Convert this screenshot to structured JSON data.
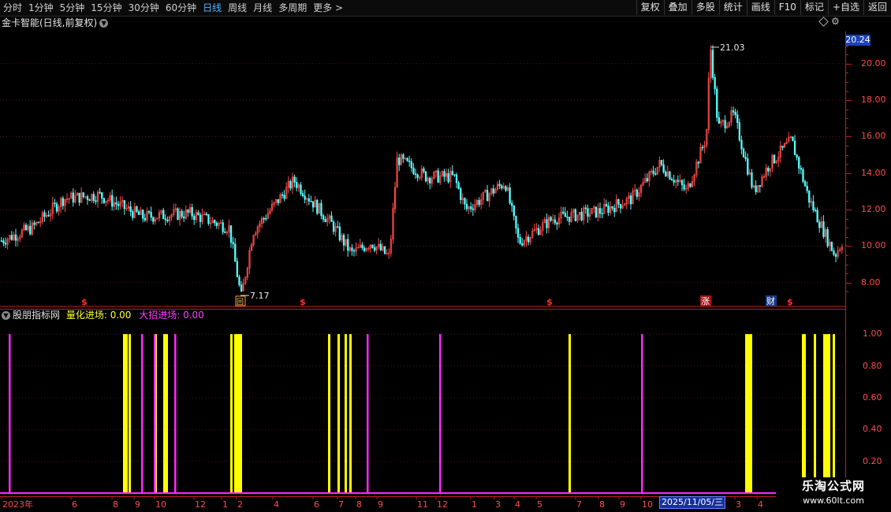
{
  "toolbar": {
    "periods": [
      "分时",
      "1分钟",
      "5分钟",
      "15分钟",
      "30分钟",
      "60分钟",
      "日线",
      "周线",
      "月线",
      "多周期",
      "更多 >"
    ],
    "active_period": "日线",
    "buttons": [
      "复权",
      "叠加",
      "多股",
      "统计",
      "画线",
      "F10",
      "标记",
      "+自选",
      "返回"
    ]
  },
  "stock_title": "金卡智能(日线,前复权)",
  "price_axis": {
    "labels": [
      "20.00",
      "18.00",
      "16.00",
      "14.00",
      "12.00",
      "10.00",
      "8.00"
    ],
    "current_price": "20.24"
  },
  "annotations": {
    "high": "21.03",
    "low": "7.17"
  },
  "event_markers": {
    "s_label": "$",
    "box_label": "回",
    "zhang_label": "涨",
    "cai_label": "财"
  },
  "indicator": {
    "name": "股朋指标网",
    "line1_label": "量化进场: 0.00",
    "line2_label": "大招进场: 0.00",
    "axis_labels": [
      "1.00",
      "0.80",
      "0.60",
      "0.40",
      "0.20"
    ]
  },
  "xaxis": {
    "labels": [
      "2023年",
      "6",
      "8",
      "9",
      "10",
      "12",
      "1",
      "2",
      "4",
      "6",
      "7",
      "8",
      "9",
      "11",
      "12",
      "1",
      "3",
      "4",
      "5",
      "7",
      "8",
      "9",
      "10",
      "3",
      "4"
    ],
    "cursor_date": "2025/11/05/三"
  },
  "watermark": {
    "line1": "乐淘公式网",
    "line2": "www.60lt.com"
  },
  "colors": {
    "up": "#ff4a4a",
    "down": "#54ffff",
    "quant_signal": "#ffff00",
    "big_signal": "#ff28ff"
  },
  "chart_data": {
    "type": "line",
    "title": "金卡智能(日线,前复权)",
    "series": [
      {
        "name": "",
        "x": [
          1,
          40,
          80,
          125,
          180,
          240,
          290,
          305,
          320,
          372,
          420,
          445,
          470,
          493,
          503,
          540,
          575,
          590,
          640,
          657,
          700,
          760,
          800,
          836,
          870,
          895,
          900,
          910,
          930,
          955,
          975,
          1003,
          1025,
          1058,
          1068
        ],
        "values": [
          10.3,
          11.0,
          12.6,
          12.8,
          11.6,
          11.8,
          11.0,
          7.17,
          10.8,
          13.6,
          11.2,
          9.6,
          10.2,
          9.4,
          14.8,
          13.8,
          13.8,
          12.0,
          13.5,
          10.2,
          11.5,
          11.9,
          12.6,
          14.5,
          13.0,
          16.0,
          21.03,
          16.5,
          17.2,
          13.0,
          14.5,
          15.8,
          12.6,
          9.5,
          10.3
        ]
      }
    ],
    "ylim": [
      7.0,
      21.5
    ]
  },
  "indicator_chart": {
    "type": "bar",
    "ylim": [
      0,
      1.08
    ],
    "quant_signal_x": [
      156,
      159,
      163,
      196,
      207,
      210,
      292,
      297,
      300,
      302,
      304,
      416,
      428,
      437,
      443,
      721,
      945,
      948,
      951,
      1017,
      1019,
      1032,
      1044,
      1047,
      1050,
      1056
    ],
    "big_signal_x": [
      11,
      179,
      195,
      221,
      465,
      557,
      813
    ]
  }
}
